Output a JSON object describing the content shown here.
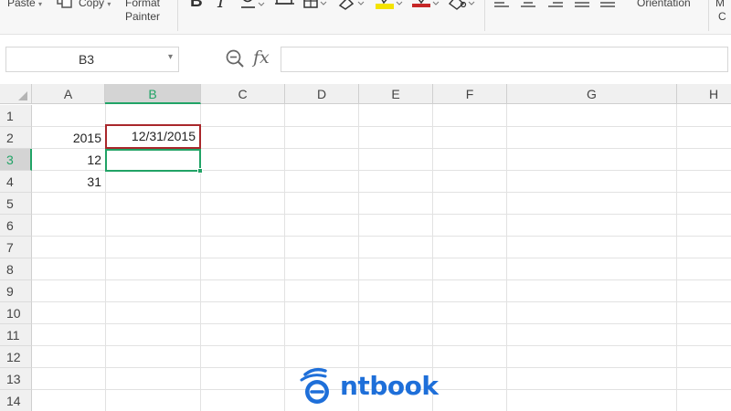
{
  "ribbon": {
    "paste_label": "Paste",
    "copy_label": "Copy",
    "format_painter_line1": "Format",
    "format_painter_line2": "Painter",
    "orientation_label": "Orientation",
    "cut_off_line1": "M",
    "cut_off_line2": "C"
  },
  "formula_bar": {
    "name_box": "B3",
    "formula_value": ""
  },
  "sheet": {
    "columns": [
      "A",
      "B",
      "C",
      "D",
      "E",
      "F",
      "G",
      "H"
    ],
    "rows": [
      "1",
      "2",
      "3",
      "4",
      "5",
      "6",
      "7",
      "8",
      "9",
      "10",
      "11",
      "12",
      "13",
      "14"
    ],
    "active_cell": "B3",
    "cells": {
      "A2": "2015",
      "A3": "12",
      "A4": "31",
      "B2": "12/31/2015",
      "B3": ""
    }
  },
  "watermark": {
    "text": "ntbook"
  },
  "colors": {
    "selection_green": "#21a366",
    "highlight_red": "#a9272b",
    "watermark_blue": "#1e6fd9"
  }
}
